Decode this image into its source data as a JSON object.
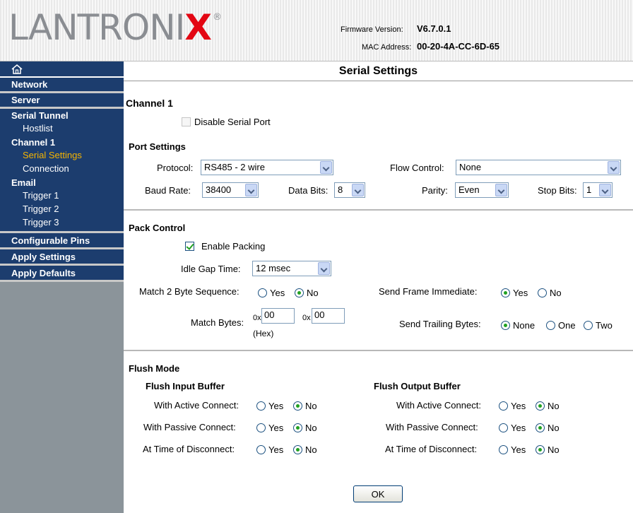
{
  "header": {
    "logo_text_main": "LANTRONI",
    "logo_text_x": "X",
    "logo_reg": "®",
    "firmware_label": "Firmware Version:",
    "firmware_value": "V6.7.0.1",
    "mac_label": "MAC Address:",
    "mac_value": "00-20-4A-CC-6D-65"
  },
  "sidebar": {
    "home_icon": "home-icon",
    "network": "Network",
    "server": "Server",
    "serial_tunnel": "Serial Tunnel",
    "hostlist": "Hostlist",
    "channel1": "Channel 1",
    "serial_settings": "Serial Settings",
    "connection": "Connection",
    "email": "Email",
    "trigger1": "Trigger 1",
    "trigger2": "Trigger 2",
    "trigger3": "Trigger 3",
    "configurable_pins": "Configurable Pins",
    "apply_settings": "Apply Settings",
    "apply_defaults": "Apply Defaults",
    "active_color": "#f5b400"
  },
  "page": {
    "title": "Serial Settings",
    "channel_title": "Channel 1",
    "disable_serial_port": "Disable Serial Port"
  },
  "port_settings": {
    "title": "Port Settings",
    "protocol_label": "Protocol:",
    "protocol_value": "RS485 - 2 wire",
    "flow_control_label": "Flow Control:",
    "flow_control_value": "None",
    "baud_rate_label": "Baud Rate:",
    "baud_rate_value": "38400",
    "data_bits_label": "Data Bits:",
    "data_bits_value": "8",
    "parity_label": "Parity:",
    "parity_value": "Even",
    "stop_bits_label": "Stop Bits:",
    "stop_bits_value": "1"
  },
  "pack_control": {
    "title": "Pack Control",
    "enable_packing": "Enable Packing",
    "idle_gap_label": "Idle Gap Time:",
    "idle_gap_value": "12 msec",
    "match2_label": "Match 2 Byte Sequence:",
    "send_frame_label": "Send Frame Immediate:",
    "match_bytes_label": "Match Bytes:",
    "hex_prefix": "0x",
    "match_byte1": "00",
    "match_byte2": "00",
    "hex_note": "(Hex)",
    "send_trailing_label": "Send Trailing Bytes:",
    "yes": "Yes",
    "no": "No",
    "none": "None",
    "one": "One",
    "two": "Two"
  },
  "flush_mode": {
    "title": "Flush Mode",
    "input_title": "Flush Input Buffer",
    "output_title": "Flush Output Buffer",
    "active_connect": "With Active Connect:",
    "passive_connect": "With Passive Connect:",
    "time_disconnect": "At Time of Disconnect:",
    "yes": "Yes",
    "no": "No"
  },
  "ok_label": "OK"
}
